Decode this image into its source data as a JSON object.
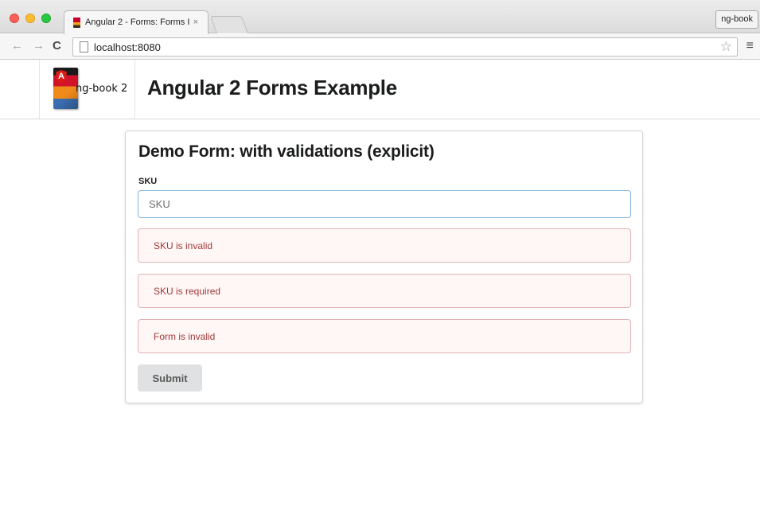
{
  "browser": {
    "tab_title": "Angular 2 - Forms: Forms I",
    "tab_close": "×",
    "profile_label": "ng-book",
    "url": "localhost:8080",
    "nav": {
      "back": "←",
      "forward": "→",
      "reload": "C"
    },
    "star": "☆",
    "menu": "≡"
  },
  "header": {
    "logo_text": "ng-book 2",
    "title": "Angular 2 Forms Example"
  },
  "form": {
    "title": "Demo Form: with validations (explicit)",
    "sku_label": "SKU",
    "sku_placeholder": "SKU",
    "sku_value": "",
    "errors": [
      "SKU is invalid",
      "SKU is required",
      "Form is invalid"
    ],
    "submit_label": "Submit"
  },
  "colors": {
    "error_text": "#9f3a38",
    "error_bg": "#fff6f6",
    "error_border": "#e0b4b4",
    "input_focus_border": "#85b7d9"
  }
}
